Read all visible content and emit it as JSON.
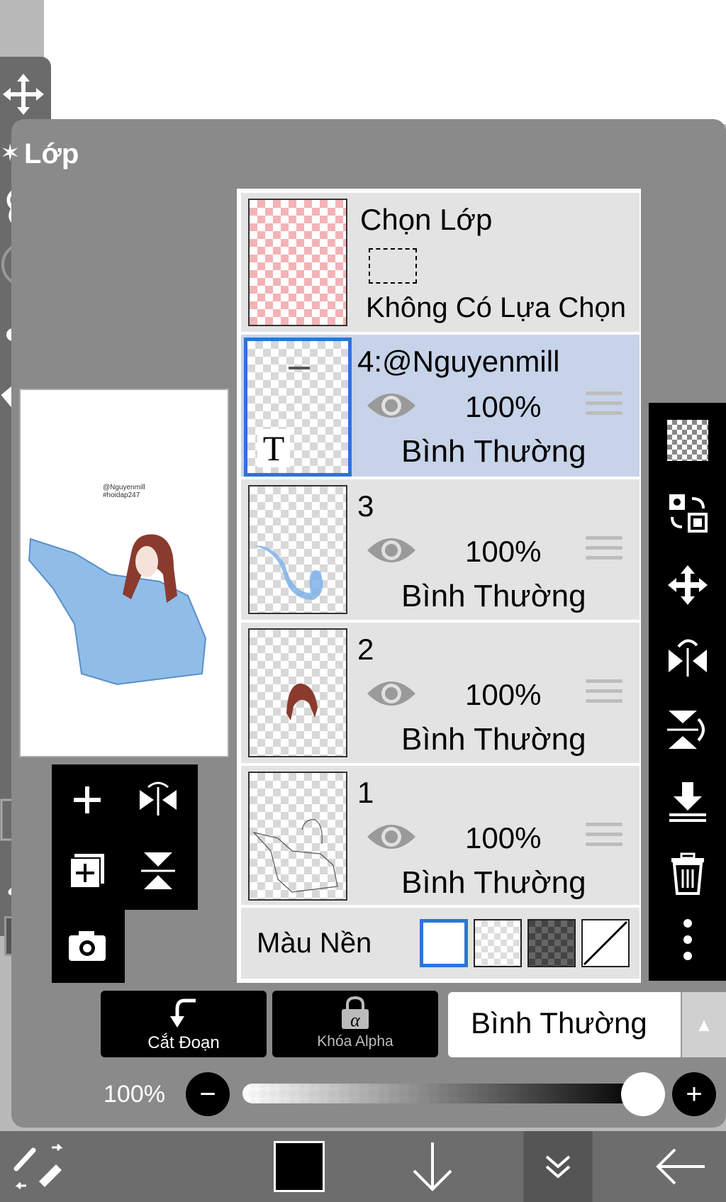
{
  "panel": {
    "title": "Lớp"
  },
  "preview": {
    "watermark_line1": "@Nguyenmill",
    "watermark_line2": "#hoidap247"
  },
  "selection_row": {
    "title": "Chọn Lớp",
    "subtitle": "Không Có Lựa Chọn"
  },
  "layers": [
    {
      "name": "4:@Nguyenmill",
      "opacity": "100%",
      "blend": "Bình Thường",
      "selected": true,
      "type": "text",
      "type_glyph": "T"
    },
    {
      "name": "3",
      "opacity": "100%",
      "blend": "Bình Thường",
      "selected": false
    },
    {
      "name": "2",
      "opacity": "100%",
      "blend": "Bình Thường",
      "selected": false
    },
    {
      "name": "1",
      "opacity": "100%",
      "blend": "Bình Thường",
      "selected": false
    }
  ],
  "background_row": {
    "label": "Màu Nền",
    "selected_index": 0
  },
  "controls": {
    "clip_label": "Cắt Đoạn",
    "alpha_lock_label": "Khóa Alpha",
    "blend_mode": "Bình Thường"
  },
  "opacity_control": {
    "label": "100%",
    "value": 100,
    "minus": "−",
    "plus": "+"
  },
  "colors": {
    "accent": "#2e74d6",
    "panel": "#8a8a8a",
    "selected_row": "#c7d3e8",
    "row": "#e3e3e3"
  },
  "icons": {
    "left_actions": [
      "plus-icon",
      "flip-horizontal-icon",
      "add-layer-icon",
      "flip-vertical-icon",
      "camera-icon"
    ],
    "right_bar": [
      "transparency-checker-icon",
      "swap-layers-icon",
      "move-icon",
      "rotate-flip-horizontal-icon",
      "rotate-flip-vertical-icon",
      "merge-down-icon",
      "trash-icon",
      "more-icon"
    ],
    "bottom_bar": [
      "brush-eraser-toggle-icon",
      "color-swatch",
      "arrow-down-icon",
      "double-chevron-down-icon",
      "back-arrow-icon"
    ]
  }
}
